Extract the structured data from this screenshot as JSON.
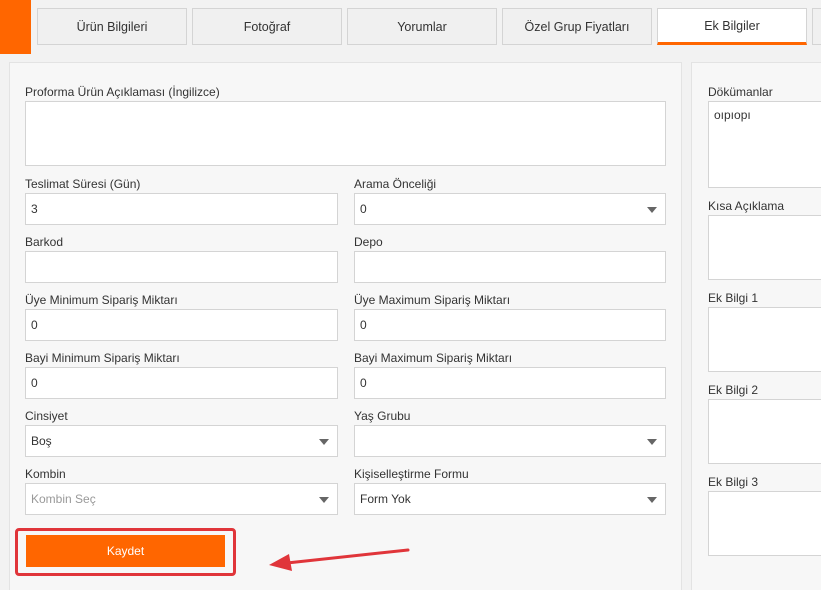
{
  "tabs": [
    {
      "label": "Ürün Bilgileri"
    },
    {
      "label": "Fotoğraf"
    },
    {
      "label": "Yorumlar"
    },
    {
      "label": "Özel Grup Fiyatları"
    },
    {
      "label": "Ek Bilgiler",
      "active": true
    }
  ],
  "form": {
    "proforma_label": "Proforma Ürün Açıklaması (İngilizce)",
    "proforma_value": "",
    "teslimat_label": "Teslimat Süresi (Gün)",
    "teslimat_value": "3",
    "arama_label": "Arama Önceliği",
    "arama_value": "0",
    "barkod_label": "Barkod",
    "barkod_value": "",
    "depo_label": "Depo",
    "depo_value": "",
    "uye_min_label": "Üye Minimum Sipariş Miktarı",
    "uye_min_value": "0",
    "uye_max_label": "Üye Maximum Sipariş Miktarı",
    "uye_max_value": "0",
    "bayi_min_label": "Bayi Minimum Sipariş Miktarı",
    "bayi_min_value": "0",
    "bayi_max_label": "Bayi Maximum Sipariş Miktarı",
    "bayi_max_value": "0",
    "cinsiyet_label": "Cinsiyet",
    "cinsiyet_value": "Boş",
    "yas_label": "Yaş Grubu",
    "yas_value": "",
    "kombin_label": "Kombin",
    "kombin_value": "Kombin Seç",
    "kisisel_label": "Kişiselleştirme Formu",
    "kisisel_value": "Form Yok",
    "save_label": "Kaydet"
  },
  "right": {
    "dokumanlar_label": "Dökümanlar",
    "dokumanlar_value": "oıpıopı",
    "kisa_label": "Kısa Açıklama",
    "ek1_label": "Ek Bilgi 1",
    "ek2_label": "Ek Bilgi 2",
    "ek3_label": "Ek Bilgi 3"
  },
  "colors": {
    "accent": "#ff6600",
    "highlight": "#e0353a"
  }
}
